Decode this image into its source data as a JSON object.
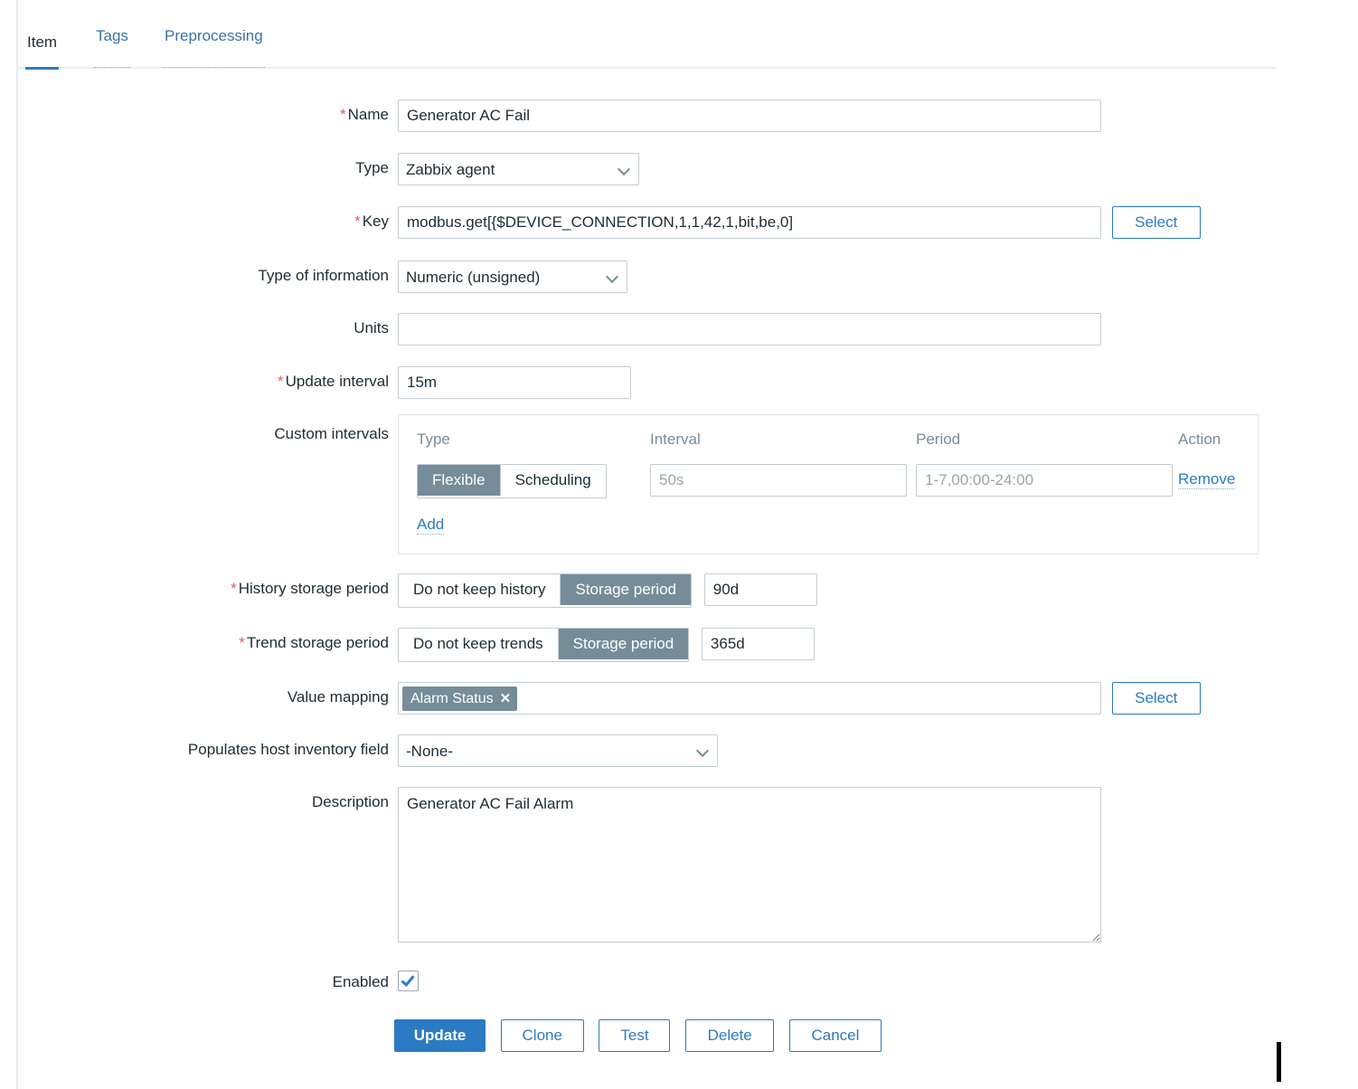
{
  "tabs": [
    {
      "label": "Item",
      "active": true
    },
    {
      "label": "Tags",
      "active": false
    },
    {
      "label": "Preprocessing",
      "active": false
    }
  ],
  "form": {
    "name": {
      "label": "Name",
      "required": "*",
      "value": "Generator AC Fail"
    },
    "type": {
      "label": "Type",
      "value": "Zabbix agent"
    },
    "key": {
      "label": "Key",
      "required": "*",
      "value": "modbus.get[{$DEVICE_CONNECTION,1,1,42,1,bit,be,0]",
      "select_button": "Select"
    },
    "type_of_information": {
      "label": "Type of information",
      "value": "Numeric (unsigned)"
    },
    "units": {
      "label": "Units",
      "value": ""
    },
    "update_interval": {
      "label": "Update interval",
      "required": "*",
      "value": "15m"
    },
    "custom_intervals": {
      "label": "Custom intervals",
      "headers": [
        "Type",
        "Interval",
        "Period",
        "Action"
      ],
      "rows": [
        {
          "type_options": [
            "Flexible",
            "Scheduling"
          ],
          "type_selected": "Flexible",
          "interval_value": "",
          "interval_placeholder": "50s",
          "period_value": "",
          "period_placeholder": "1-7,00:00-24:00",
          "action_label": "Remove"
        }
      ],
      "add_label": "Add"
    },
    "history_storage_period": {
      "label": "History storage period",
      "required": "*",
      "options": [
        "Do not keep history",
        "Storage period"
      ],
      "selected": "Storage period",
      "value": "90d"
    },
    "trend_storage_period": {
      "label": "Trend storage period",
      "required": "*",
      "options": [
        "Do not keep trends",
        "Storage period"
      ],
      "selected": "Storage period",
      "value": "365d"
    },
    "value_mapping": {
      "label": "Value mapping",
      "chip": "Alarm Status",
      "chip_remove": "✕",
      "select_button": "Select"
    },
    "host_inventory_field": {
      "label": "Populates host inventory field",
      "value": "-None-"
    },
    "description": {
      "label": "Description",
      "value": "Generator AC Fail Alarm"
    },
    "enabled": {
      "label": "Enabled",
      "checked": true
    }
  },
  "footer_buttons": [
    {
      "label": "Update",
      "primary": true
    },
    {
      "label": "Clone",
      "primary": false
    },
    {
      "label": "Test",
      "primary": false
    },
    {
      "label": "Delete",
      "primary": false
    },
    {
      "label": "Cancel",
      "primary": false
    }
  ],
  "colors": {
    "accent": "#2b7ac4",
    "required": "#e45959",
    "segment_selected": "#768d99",
    "border": "#c3ccd4"
  }
}
